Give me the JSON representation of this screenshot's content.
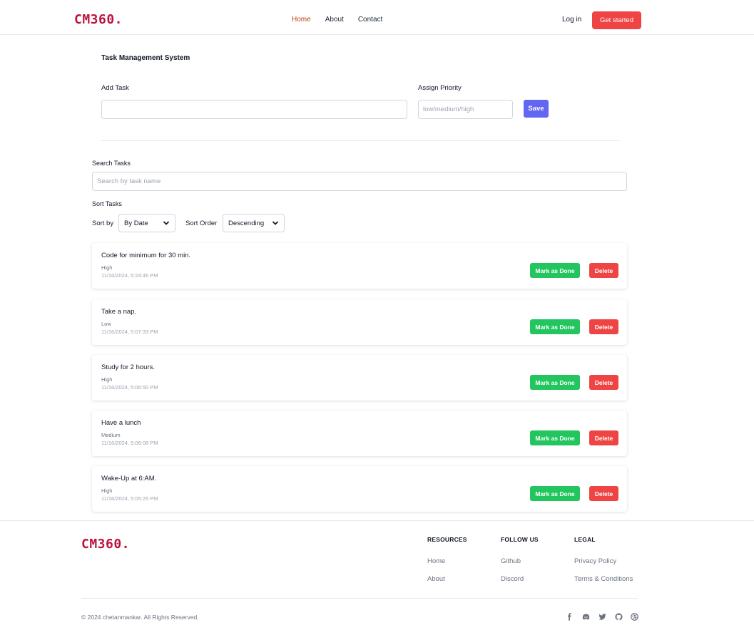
{
  "header": {
    "logo": "CM360.",
    "nav": [
      {
        "label": "Home",
        "active": true
      },
      {
        "label": "About",
        "active": false
      },
      {
        "label": "Contact",
        "active": false
      }
    ],
    "login": "Log in",
    "cta": "Get started"
  },
  "form": {
    "title": "Task Management System",
    "add_task_label": "Add Task",
    "add_task_value": "",
    "priority_label": "Assign Priority",
    "priority_placeholder": "low/medium/high",
    "save": "Save"
  },
  "search": {
    "label": "Search Tasks",
    "placeholder": "Search by task name"
  },
  "sort": {
    "label": "Sort Tasks",
    "sort_by_label": "Sort by",
    "sort_by_value": "By Date",
    "order_label": "Sort Order",
    "order_value": "Descending"
  },
  "tasks": [
    {
      "name": "Code for minimum for 30 min.",
      "priority": "High",
      "date": "11/16/2024, 5:24:46 PM"
    },
    {
      "name": "Take a nap.",
      "priority": "Low",
      "date": "11/16/2024, 5:07:33 PM"
    },
    {
      "name": "Study for 2 hours.",
      "priority": "High",
      "date": "11/16/2024, 5:06:50 PM"
    },
    {
      "name": "Have a lunch",
      "priority": "Medium",
      "date": "11/16/2024, 5:06:08 PM"
    },
    {
      "name": "Wake-Up at 6:AM.",
      "priority": "High",
      "date": "11/16/2024, 5:05:25 PM"
    }
  ],
  "task_actions": {
    "done": "Mark as Done",
    "delete": "Delete"
  },
  "footer": {
    "logo": "CM360.",
    "columns": [
      {
        "heading": "RESOURCES",
        "links": [
          "Home",
          "About"
        ]
      },
      {
        "heading": "FOLLOW US",
        "links": [
          "Github",
          "Discord"
        ]
      },
      {
        "heading": "LEGAL",
        "links": [
          "Privacy Policy",
          "Terms & Conditions"
        ]
      }
    ],
    "copyright": "© 2024 chetanmankar. All Rights Reserved.",
    "social_icons": [
      "facebook-icon",
      "discord-icon",
      "twitter-icon",
      "github-icon",
      "dribbble-icon"
    ]
  },
  "colors": {
    "brand": "#be123c",
    "accent_red": "#ef4444",
    "save_indigo": "#6366f1",
    "done_green": "#22c55e",
    "nav_active": "#c2410c"
  }
}
